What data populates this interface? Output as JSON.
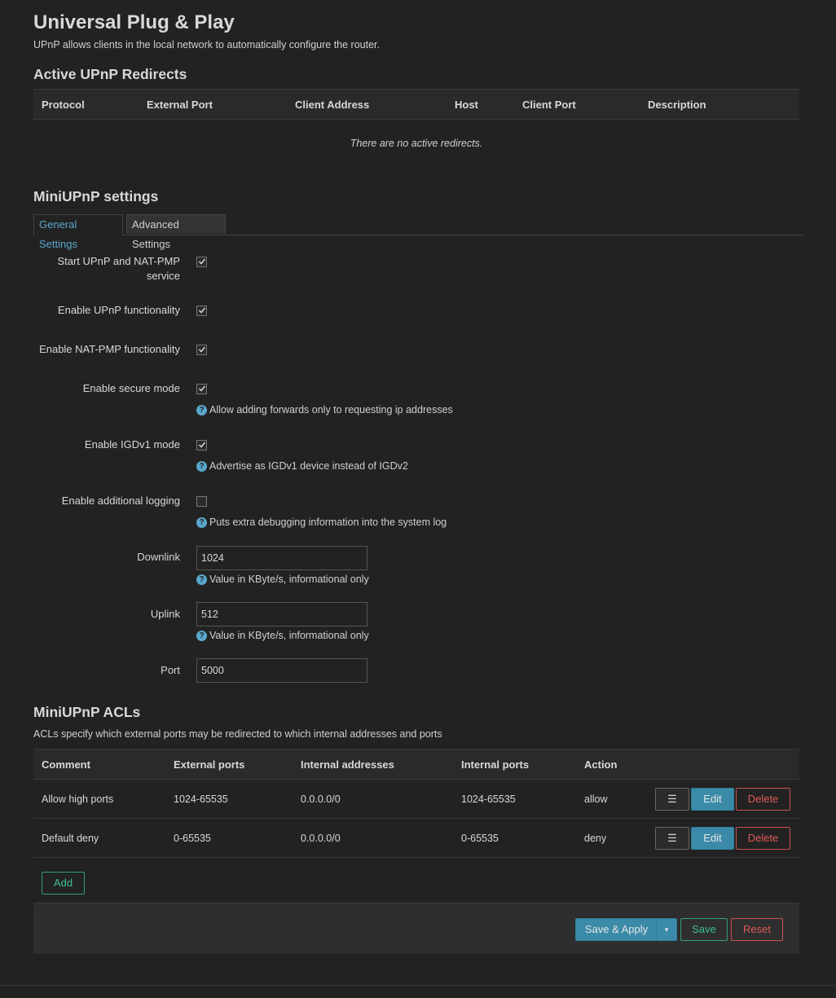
{
  "page": {
    "title": "Universal Plug & Play",
    "description": "UPnP allows clients in the local network to automatically configure the router."
  },
  "redirects": {
    "title": "Active UPnP Redirects",
    "columns": [
      "Protocol",
      "External Port",
      "Client Address",
      "Host",
      "Client Port",
      "Description"
    ],
    "empty_text": "There are no active redirects."
  },
  "settings": {
    "title": "MiniUPnP settings",
    "tabs": [
      "General Settings",
      "Advanced Settings"
    ],
    "active_tab": "General Settings",
    "fields": {
      "start_service": {
        "label_line1": "Start UPnP and NAT-PMP",
        "label_line2": "service",
        "checked": true
      },
      "enable_upnp": {
        "label": "Enable UPnP functionality",
        "checked": true
      },
      "enable_natpmp": {
        "label": "Enable NAT-PMP functionality",
        "checked": true
      },
      "secure_mode": {
        "label": "Enable secure mode",
        "checked": true,
        "help": "Allow adding forwards only to requesting ip addresses"
      },
      "igdv1": {
        "label": "Enable IGDv1 mode",
        "checked": true,
        "help": "Advertise as IGDv1 device instead of IGDv2"
      },
      "logging": {
        "label": "Enable additional logging",
        "checked": false,
        "help": "Puts extra debugging information into the system log"
      },
      "downlink": {
        "label": "Downlink",
        "value": "1024",
        "help": "Value in KByte/s, informational only"
      },
      "uplink": {
        "label": "Uplink",
        "value": "512",
        "help": "Value in KByte/s, informational only"
      },
      "port": {
        "label": "Port",
        "value": "5000"
      }
    }
  },
  "acls": {
    "title": "MiniUPnP ACLs",
    "description": "ACLs specify which external ports may be redirected to which internal addresses and ports",
    "columns": [
      "Comment",
      "External ports",
      "Internal addresses",
      "Internal ports",
      "Action"
    ],
    "rows": [
      {
        "comment": "Allow high ports",
        "external_ports": "1024-65535",
        "internal_addresses": "0.0.0.0/0",
        "internal_ports": "1024-65535",
        "action": "allow"
      },
      {
        "comment": "Default deny",
        "external_ports": "0-65535",
        "internal_addresses": "0.0.0.0/0",
        "internal_ports": "0-65535",
        "action": "deny"
      }
    ],
    "row_buttons": {
      "menu": "☰",
      "edit": "Edit",
      "delete": "Delete"
    },
    "add_label": "Add"
  },
  "footer": {
    "save_apply": "Save & Apply",
    "dropdown": "▾",
    "save": "Save",
    "reset": "Reset"
  },
  "colors": {
    "background": "#222222",
    "accent": "#3a8aa8",
    "positive": "#3cc28e",
    "negative": "#e05a56",
    "link": "#5aa7cc"
  }
}
